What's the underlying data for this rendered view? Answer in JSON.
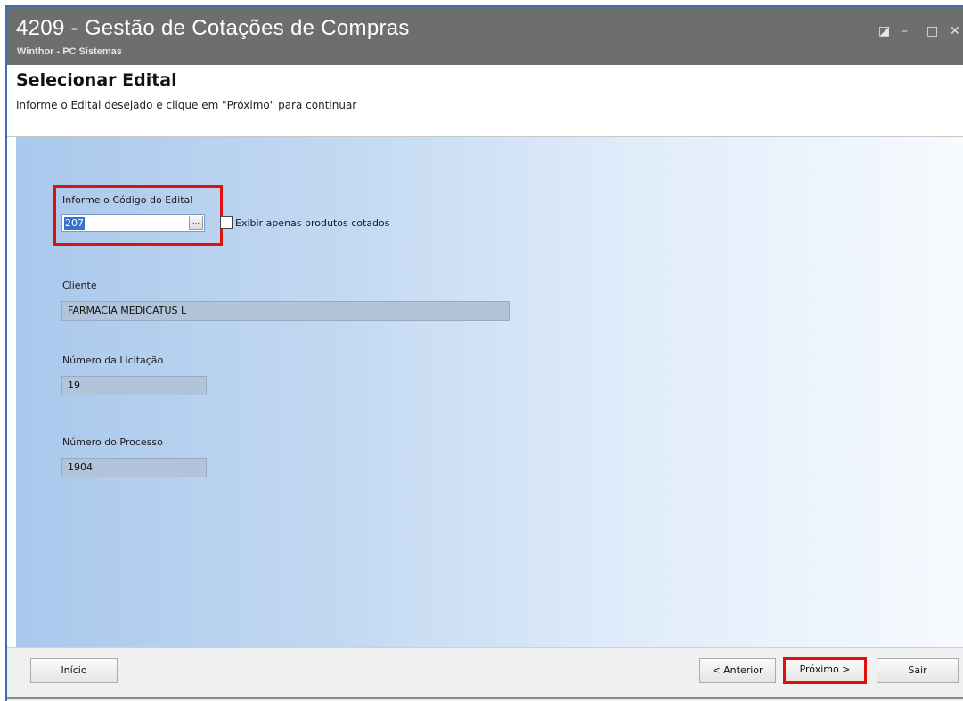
{
  "window": {
    "title": "4209 - Gestão de Cotações de Compras",
    "subtitle": "Winthor - PC Sistemas",
    "controls": [
      "restore-icon",
      "minimize-icon",
      "maximize-icon",
      "close-icon"
    ]
  },
  "header": {
    "title": "Selecionar Edital",
    "subtitle": "Informe o Edital desejado e clique em \"Próximo\" para continuar"
  },
  "form": {
    "codigo_label": "Informe o Código do Edital",
    "codigo_value": "207",
    "lookup_label": "...",
    "checkbox_label": "Exibir apenas produtos cotados",
    "checkbox_checked": false,
    "cliente_label": "Cliente",
    "cliente_value": "FARMACIA MEDICATUS L",
    "licitacao_label": "Número da Licitação",
    "licitacao_value": "19",
    "processo_label": "Número do Processo",
    "processo_value": "1904"
  },
  "footer": {
    "inicio": "Início",
    "anterior": "< Anterior",
    "proximo": "Próximo >",
    "sair": "Sair"
  },
  "colors": {
    "highlight": "#e01010",
    "titlebar": "#6e6e6e",
    "gradient_start": "#a9c8ec"
  }
}
